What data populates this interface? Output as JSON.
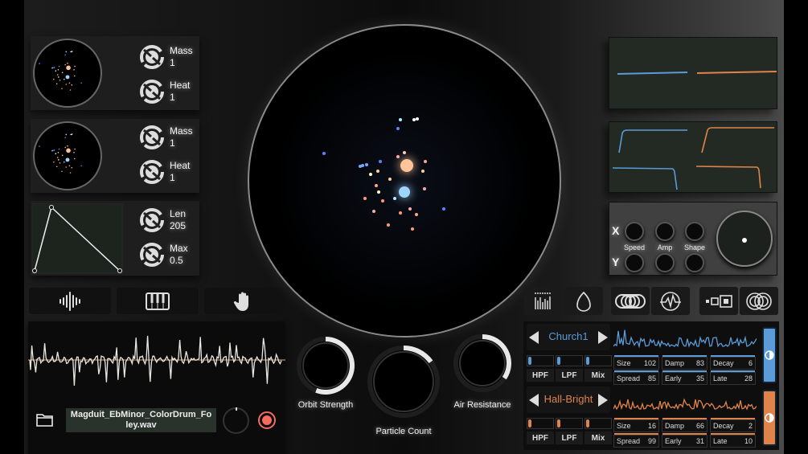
{
  "left_panels": [
    {
      "knobs": [
        {
          "label": "Mass",
          "value": "1"
        },
        {
          "label": "Heat",
          "value": "1"
        }
      ]
    },
    {
      "knobs": [
        {
          "label": "Mass",
          "value": "1"
        },
        {
          "label": "Heat",
          "value": "1"
        }
      ]
    },
    {
      "knobs": [
        {
          "label": "Len",
          "value": "205"
        },
        {
          "label": "Max",
          "value": "0.5"
        }
      ]
    }
  ],
  "mode_tabs": [
    "waveform-icon",
    "piano-icon",
    "hand-icon"
  ],
  "sample": {
    "filename": "Magduit_EbMinor_ColorDrum_Foley.wav",
    "icons": [
      "folder-icon",
      "record-icon"
    ]
  },
  "center_knobs": [
    {
      "label": "Orbit Strength",
      "level": 0.6
    },
    {
      "label": "Particle Count",
      "level": 0.12
    },
    {
      "label": "Air Resistance",
      "level": 0.35
    }
  ],
  "xy": {
    "x_label": "X",
    "y_label": "Y",
    "params": [
      "Speed",
      "Amp",
      "Shape"
    ]
  },
  "fx_tabs": [
    "bars-icon",
    "egg-icon",
    "rings-icon",
    "pulse-icon",
    "squares-icon",
    "circles-icon"
  ],
  "colors": {
    "blue": "#5a9bd8",
    "orange": "#e0834a",
    "record": "#f26b5e"
  },
  "reverbs": [
    {
      "preset": "Church1",
      "color": "#5a9bd8",
      "filters": [
        "HPF",
        "LPF",
        "Mix"
      ],
      "params": [
        {
          "label": "Size",
          "value": "102"
        },
        {
          "label": "Damp",
          "value": "83"
        },
        {
          "label": "Decay",
          "value": "6"
        },
        {
          "label": "Spread",
          "value": "85"
        },
        {
          "label": "Early",
          "value": "35"
        },
        {
          "label": "Late",
          "value": "28"
        }
      ]
    },
    {
      "preset": "Hall-Bright",
      "color": "#e0834a",
      "filters": [
        "HPF",
        "LPF",
        "Mix"
      ],
      "params": [
        {
          "label": "Size",
          "value": "16"
        },
        {
          "label": "Damp",
          "value": "66"
        },
        {
          "label": "Decay",
          "value": "2"
        },
        {
          "label": "Spread",
          "value": "99"
        },
        {
          "label": "Early",
          "value": "31"
        },
        {
          "label": "Late",
          "value": "10"
        }
      ]
    }
  ]
}
